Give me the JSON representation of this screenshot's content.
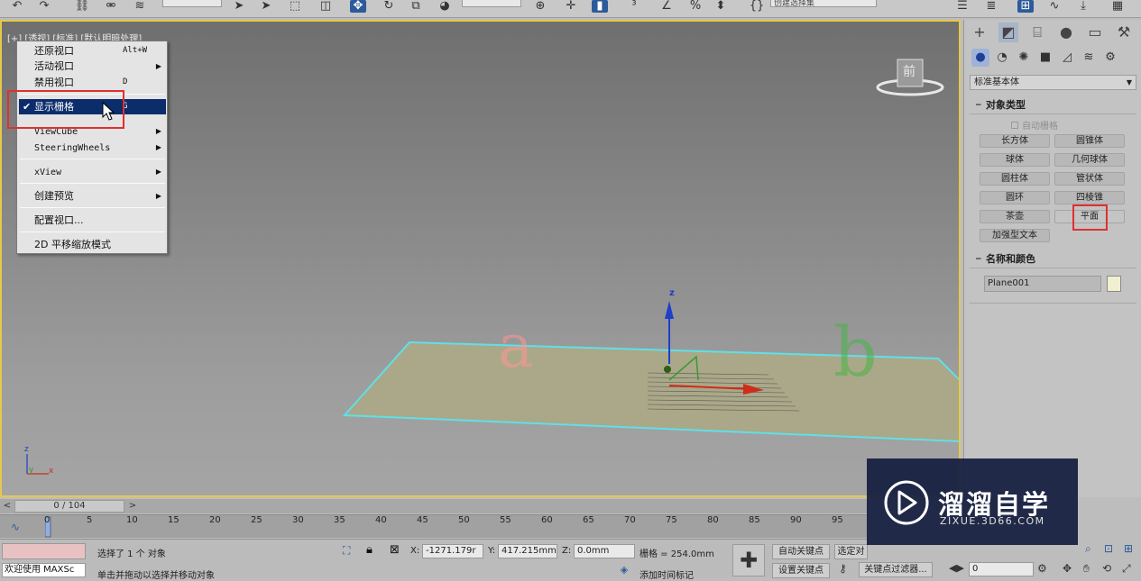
{
  "viewport": {
    "label": "[+] [透视] [标准] [默认明暗处理]",
    "viewcube_label": "前",
    "letter_a": "a",
    "letter_b": "b",
    "axis_z": "z",
    "corner_axes": {
      "z": "z",
      "y": "y",
      "x": "x"
    }
  },
  "context_menu": {
    "items": [
      {
        "label": "还原视口",
        "shortcut": "Alt+W",
        "submenu": false
      },
      {
        "label": "活动视口",
        "shortcut": "",
        "submenu": true
      },
      {
        "label": "禁用视口",
        "shortcut": "D",
        "submenu": false
      },
      {
        "label": "显示栅格",
        "shortcut": "G",
        "checked": true,
        "highlighted": true
      },
      {
        "label": "ViewCube",
        "submenu": true
      },
      {
        "label": "SteeringWheels",
        "submenu": true
      },
      {
        "label": "xView",
        "submenu": true
      },
      {
        "label": "创建预览",
        "submenu": true
      },
      {
        "label": "配置视口...",
        "submenu": false
      },
      {
        "label": "2D 平移缩放模式",
        "submenu": false
      }
    ],
    "check_glyph": "✔",
    "arrow_glyph": "▶"
  },
  "command_panel": {
    "category_dropdown": "标准基本体",
    "object_type": {
      "title": "对象类型",
      "autogrid_label": "自动栅格",
      "buttons": [
        "长方体",
        "圆锥体",
        "球体",
        "几何球体",
        "圆柱体",
        "管状体",
        "圆环",
        "四棱锥",
        "茶壶",
        "平面",
        "加强型文本"
      ]
    },
    "name_color": {
      "title": "名称和颜色",
      "name_value": "Plane001",
      "swatch_color": "#f0f0d0"
    },
    "collapse_glyph": "▲",
    "dropdown_arrow": "▼"
  },
  "time_slider": {
    "value_label": "0 / 104",
    "prev_label": "<",
    "next_label": ">",
    "ticks": [
      "0",
      "5",
      "10",
      "15",
      "20",
      "25",
      "30",
      "35",
      "40",
      "45",
      "50",
      "55",
      "60",
      "65",
      "70",
      "75",
      "80",
      "85",
      "90",
      "95"
    ]
  },
  "status": {
    "welcome_text": "欢迎使用 MAXSc",
    "selection_text": "选择了 1 个 对象",
    "prompt_text": "单击并拖动以选择并移动对象",
    "x_label": "X:",
    "x_value": "-1271.179r",
    "y_label": "Y:",
    "y_value": "417.215mm",
    "z_label": "Z:",
    "z_value": "0.0mm",
    "grid_text": "栅格 = 254.0mm",
    "autokey_label": "自动关键点",
    "setkey_label": "设置关键点",
    "selected_label": "选定对",
    "keyfilter_label": "关键点过滤器...",
    "add_time_tag": "添加时间标记",
    "frame_value": "0"
  },
  "toolbar": {
    "selection_set_placeholder": "创建选择集"
  },
  "watermark": {
    "title": "溜溜自学",
    "url": "ZIXUE.3D66.COM"
  },
  "colors": {
    "viewport_border": "#e5c94a",
    "highlight": "#0b2d6b",
    "red_annotation": "#e03030",
    "plane_edge": "#5fe0e8"
  }
}
